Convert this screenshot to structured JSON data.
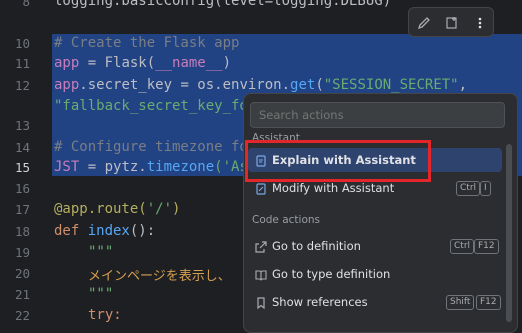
{
  "editor": {
    "line_numbers": [
      "8",
      "10",
      "11",
      "12",
      "",
      "13",
      "14",
      "15",
      "16",
      "17",
      "18",
      "19",
      "20",
      "21",
      "22"
    ],
    "current_line": "15",
    "lines": {
      "l8": "logging.basicConfig(level=logging.DEBUG)",
      "l10": "# Create the Flask app",
      "l11_a": "app",
      "l11_b": " = Flask(",
      "l11_c": "__name__",
      "l11_d": ")",
      "l12_a": "app",
      "l12_b": ".secret_key = os.environ.",
      "l12_c": "get",
      "l12_d": "(",
      "l12_e": "\"SESSION_SECRET\"",
      "l12_f": ",",
      "l12w": "\"fallback_secret_key_fo",
      "l14": "# Configure timezone fo",
      "l15_a": "JST",
      "l15_b": " = pytz.",
      "l15_c": "timezone",
      "l15_d": "('As",
      "l17_a": "@app.route(",
      "l17_b": "'/'",
      "l17_c": ")",
      "l18_a": "def ",
      "l18_b": "index",
      "l18_c": "():",
      "l19": "\"\"\"",
      "l20": "メインページを表示し、",
      "l21": "\"\"\"",
      "l22": "try:"
    }
  },
  "toolbar": {
    "icons": [
      "edit-pencil-icon",
      "assistant-add-icon",
      "more-vert-icon"
    ]
  },
  "popup": {
    "search_placeholder": "Search actions",
    "section_assistant": "Assistant",
    "section_code_actions": "Code actions",
    "items": [
      {
        "label": "Explain with Assistant",
        "icon": "assistant-explain-icon",
        "keys": []
      },
      {
        "label": "Modify with Assistant",
        "icon": "assistant-modify-icon",
        "keys": [
          "Ctrl",
          "I"
        ]
      },
      {
        "label": "Go to definition",
        "icon": "external-link-icon",
        "keys": [
          "Ctrl",
          "F12"
        ]
      },
      {
        "label": "Go to type definition",
        "icon": "book-icon",
        "keys": []
      },
      {
        "label": "Show references",
        "icon": "bookmark-icon",
        "keys": [
          "Shift",
          "F12"
        ]
      }
    ]
  },
  "colors": {
    "selection": "#214283",
    "active_item": "#2e436e",
    "highlight_border": "#e3262a"
  }
}
